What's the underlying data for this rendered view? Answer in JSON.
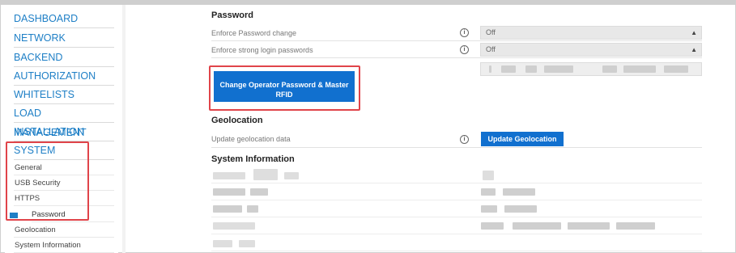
{
  "sidebar": {
    "items": [
      {
        "label": "DASHBOARD"
      },
      {
        "label": "NETWORK"
      },
      {
        "label": "BACKEND"
      },
      {
        "label": "AUTHORIZATION"
      },
      {
        "label": "WHITELISTS"
      },
      {
        "label": "LOAD MANAGEMENT"
      },
      {
        "label": "INSTALLATION"
      },
      {
        "label": "SYSTEM"
      }
    ],
    "sub_items": [
      {
        "label": "General"
      },
      {
        "label": "USB Security"
      },
      {
        "label": "HTTPS"
      },
      {
        "label": "Password"
      },
      {
        "label": "Geolocation"
      },
      {
        "label": "System Information"
      }
    ],
    "active_sub_item": "Password"
  },
  "password_section": {
    "title": "Password",
    "rows": [
      {
        "label": "Enforce Password change",
        "value": "Off"
      },
      {
        "label": "Enforce strong login passwords",
        "value": "Off"
      }
    ],
    "change_button_label": "Change Operator Password & Master RFID"
  },
  "geolocation_section": {
    "title": "Geolocation",
    "row_label": "Update geolocation data",
    "button_label": "Update Geolocation"
  },
  "system_info_section": {
    "title": "System Information"
  },
  "icons": {
    "info": "info-circle-icon",
    "select_arrow": "updown-arrow-icon"
  },
  "colors": {
    "accent": "#1e7fc6",
    "button": "#1170cf",
    "highlight": "#e0444a"
  }
}
